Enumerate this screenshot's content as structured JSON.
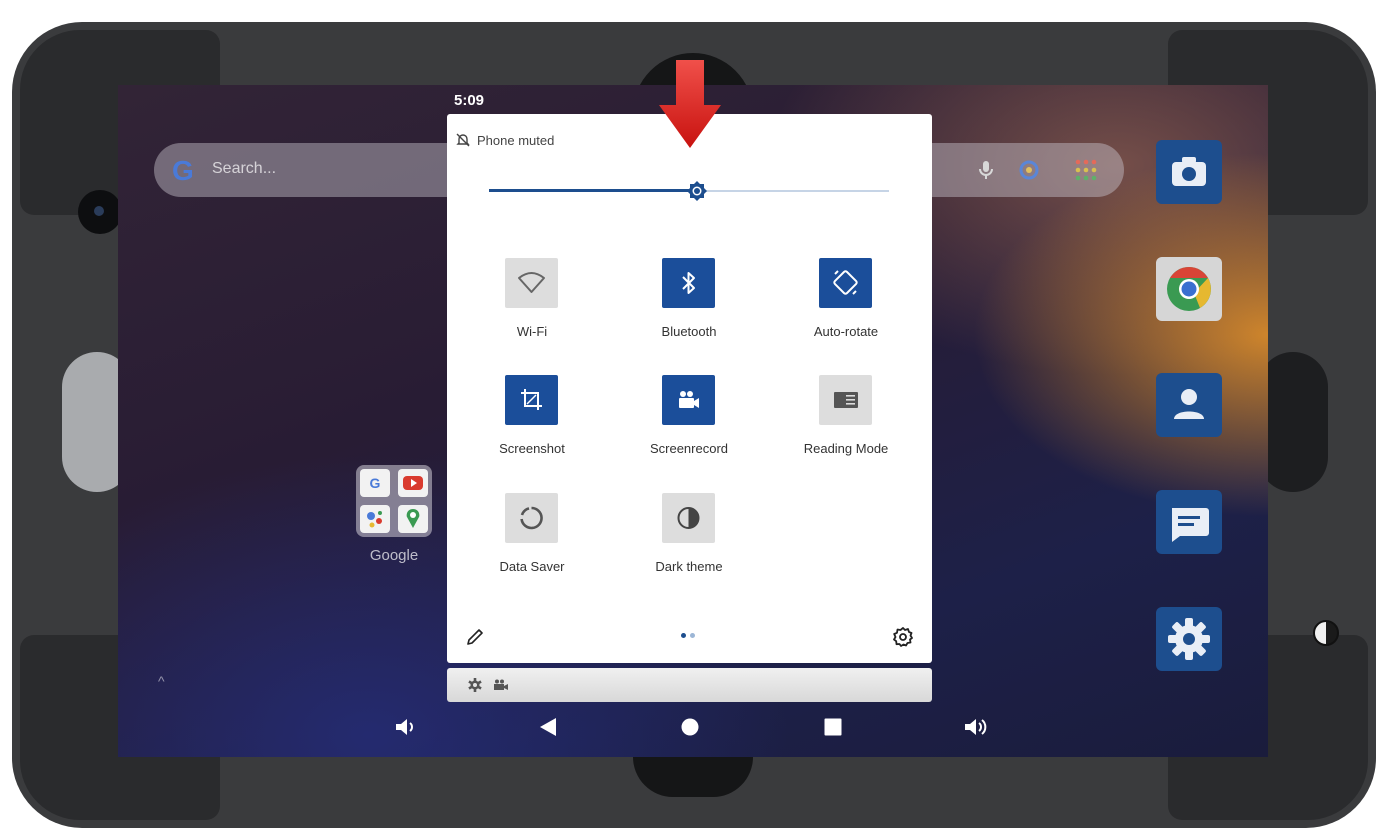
{
  "status_bar": {
    "time": "5:09"
  },
  "home": {
    "search_placeholder": "Search...",
    "folder": {
      "label": "Google"
    },
    "dock": [
      "camera-app",
      "chrome-app",
      "contacts-app",
      "messages-app",
      "settings-app"
    ]
  },
  "quick_settings": {
    "notice": "Phone muted",
    "brightness_level": 0.52,
    "tiles": [
      {
        "label": "Wi-Fi",
        "icon": "wifi-icon",
        "on": false
      },
      {
        "label": "Bluetooth",
        "icon": "bluetooth-icon",
        "on": true
      },
      {
        "label": "Auto-rotate",
        "icon": "auto-rotate-icon",
        "on": true
      },
      {
        "label": "Screenshot",
        "icon": "screenshot-icon",
        "on": true
      },
      {
        "label": "Screenrecord",
        "icon": "screenrecord-icon",
        "on": true
      },
      {
        "label": "Reading Mode",
        "icon": "reading-mode-icon",
        "on": false
      },
      {
        "label": "Data Saver",
        "icon": "data-saver-icon",
        "on": false
      },
      {
        "label": "Dark theme",
        "icon": "dark-theme-icon",
        "on": false
      }
    ],
    "page_indicator": {
      "pages": 2,
      "current": 1
    }
  },
  "colors": {
    "tile_on": "#1b4e9a",
    "tile_off": "#dddddd",
    "slider_fill": "#1d4e8e",
    "annotation_arrow": "#e8201e"
  }
}
